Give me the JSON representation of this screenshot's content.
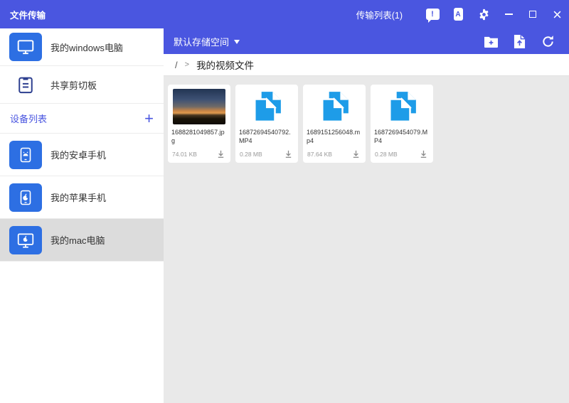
{
  "titlebar": {
    "title": "文件传输",
    "transfer_list_label": "传输列表(1)",
    "feedback_glyph": "!",
    "phone_glyph": "A"
  },
  "sidebar": {
    "computer_label": "我的windows电脑",
    "clipboard_label": "共享剪切板",
    "device_list_title": "设备列表",
    "add_device_label": "+",
    "devices": [
      {
        "label": "我的安卓手机",
        "type": "android-phone",
        "selected": false
      },
      {
        "label": "我的苹果手机",
        "type": "apple-phone",
        "selected": false
      },
      {
        "label": "我的mac电脑",
        "type": "mac-computer",
        "selected": true
      }
    ]
  },
  "toolbar": {
    "storage_label": "默认存储空间"
  },
  "breadcrumb": {
    "root": "/",
    "separator": ">",
    "current": "我的视频文件"
  },
  "files": [
    {
      "name": "1688281049857.jpg",
      "size": "74.01 KB",
      "kind": "image-thumbnail"
    },
    {
      "name": "16872694540792.MP4",
      "size": "0.28 MB",
      "kind": "video-file"
    },
    {
      "name": "1689151256048.mp4",
      "size": "87.64 KB",
      "kind": "video-file"
    },
    {
      "name": "1687269454079.MP4",
      "size": "0.28 MB",
      "kind": "video-file"
    }
  ],
  "colors": {
    "accent": "#4a56e0",
    "sidebar_icon_blue": "#2d6fe3",
    "file_icon_blue": "#1e9ce8",
    "selected_row": "#dcdcdc",
    "content_bg": "#e9e9e9"
  }
}
